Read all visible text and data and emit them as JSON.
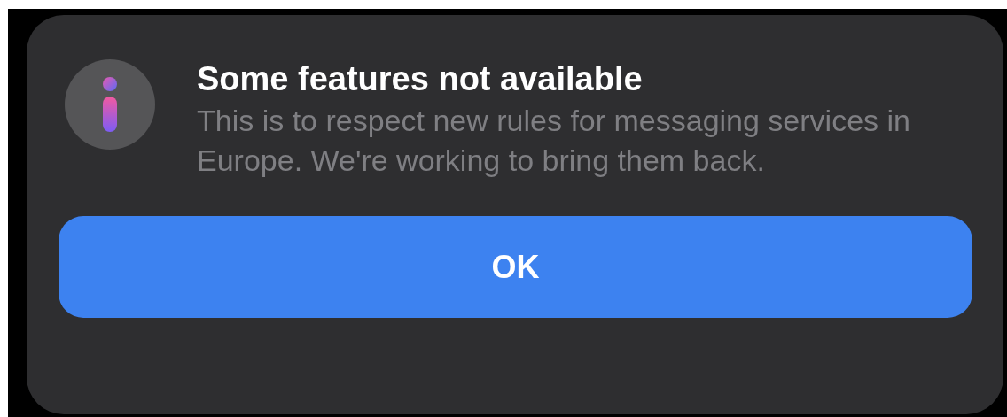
{
  "dialog": {
    "title": "Some features not available",
    "message": "This is to respect new rules for messaging services in Europe. We're working to bring them back.",
    "buttons": [
      "OK"
    ]
  }
}
